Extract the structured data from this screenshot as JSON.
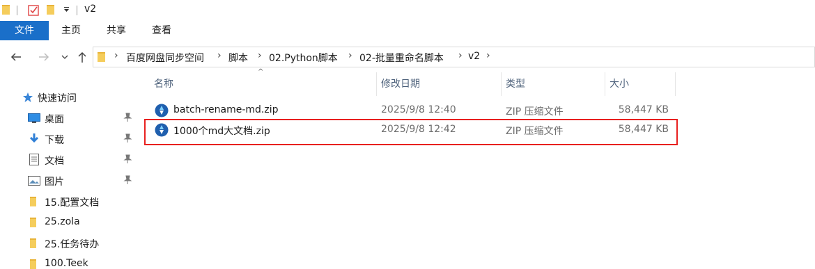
{
  "window": {
    "title": "v2"
  },
  "ribbon": {
    "tabs": [
      "文件",
      "主页",
      "共享",
      "查看"
    ]
  },
  "address": {
    "breadcrumbs": [
      "百度网盘同步空间",
      "脚本",
      "02.Python脚本",
      "02-批量重命名脚本",
      "v2"
    ]
  },
  "columns": {
    "name": "名称",
    "modified": "修改日期",
    "type": "类型",
    "size": "大小"
  },
  "sidebar": {
    "quick_access": "快速访问",
    "items": [
      {
        "label": "桌面",
        "icon": "desktop-icon",
        "pinned": true
      },
      {
        "label": "下载",
        "icon": "download-icon",
        "pinned": true
      },
      {
        "label": "文档",
        "icon": "document-icon",
        "pinned": true
      },
      {
        "label": "图片",
        "icon": "picture-icon",
        "pinned": true
      },
      {
        "label": "15.配置文档",
        "icon": "folder-icon",
        "pinned": false
      },
      {
        "label": "25.zola",
        "icon": "folder-icon",
        "pinned": false
      },
      {
        "label": "25.任务待办",
        "icon": "folder-icon",
        "pinned": false
      },
      {
        "label": "100.Teek",
        "icon": "folder-icon",
        "pinned": false
      }
    ]
  },
  "files": [
    {
      "name": "batch-rename-md.zip",
      "modified": "2025/9/8 12:40",
      "type": "ZIP 压缩文件",
      "size": "58,447 KB",
      "highlighted": false
    },
    {
      "name": "1000个md大文档.zip",
      "modified": "2025/9/8 12:42",
      "type": "ZIP 压缩文件",
      "size": "58,447 KB",
      "highlighted": true
    }
  ],
  "colors": {
    "file_tab": "#1a6fc9",
    "highlight_border": "#e8201f",
    "folder": "#f2c94c",
    "header_text": "#4c607a"
  }
}
